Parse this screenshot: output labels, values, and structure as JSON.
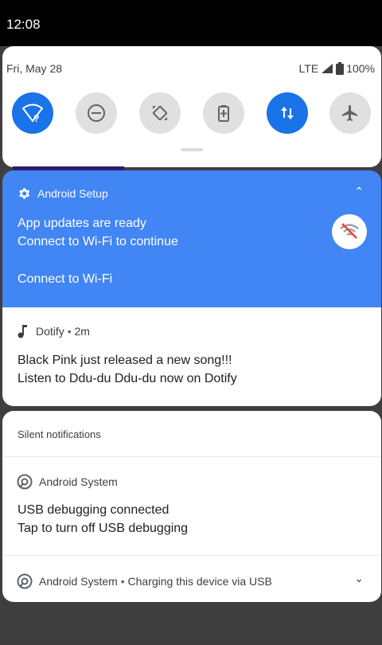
{
  "status_bar": {
    "time": "12:08"
  },
  "quick_settings": {
    "date": "Fri, May 28",
    "network": "LTE",
    "battery": "100%",
    "tiles": [
      {
        "name": "wifi",
        "state": "on"
      },
      {
        "name": "do-not-disturb",
        "state": "off"
      },
      {
        "name": "auto-rotate",
        "state": "off"
      },
      {
        "name": "battery-saver",
        "state": "off"
      },
      {
        "name": "mobile-data",
        "state": "on"
      },
      {
        "name": "airplane-mode",
        "state": "off"
      }
    ]
  },
  "setup_notification": {
    "app": "Android Setup",
    "title": "App updates are ready",
    "text": "Connect to Wi-Fi to continue",
    "action": "Connect to Wi-Fi"
  },
  "dotify_notification": {
    "app": "Dotify",
    "time": "2m",
    "line1": "Black Pink just released a new song!!!",
    "line2": "Listen to Ddu-du Ddu-du now on Dotify"
  },
  "silent": {
    "section_title": "Silent notifications",
    "usb": {
      "app": "Android System",
      "title": "USB debugging connected",
      "text": "Tap to turn off USB debugging"
    },
    "charging": {
      "app": "Android System",
      "text": "Charging this device via USB"
    }
  },
  "colors": {
    "accent": "#1a73e8",
    "setup_card": "#4285f4",
    "tile_off": "#e0e0e0"
  }
}
